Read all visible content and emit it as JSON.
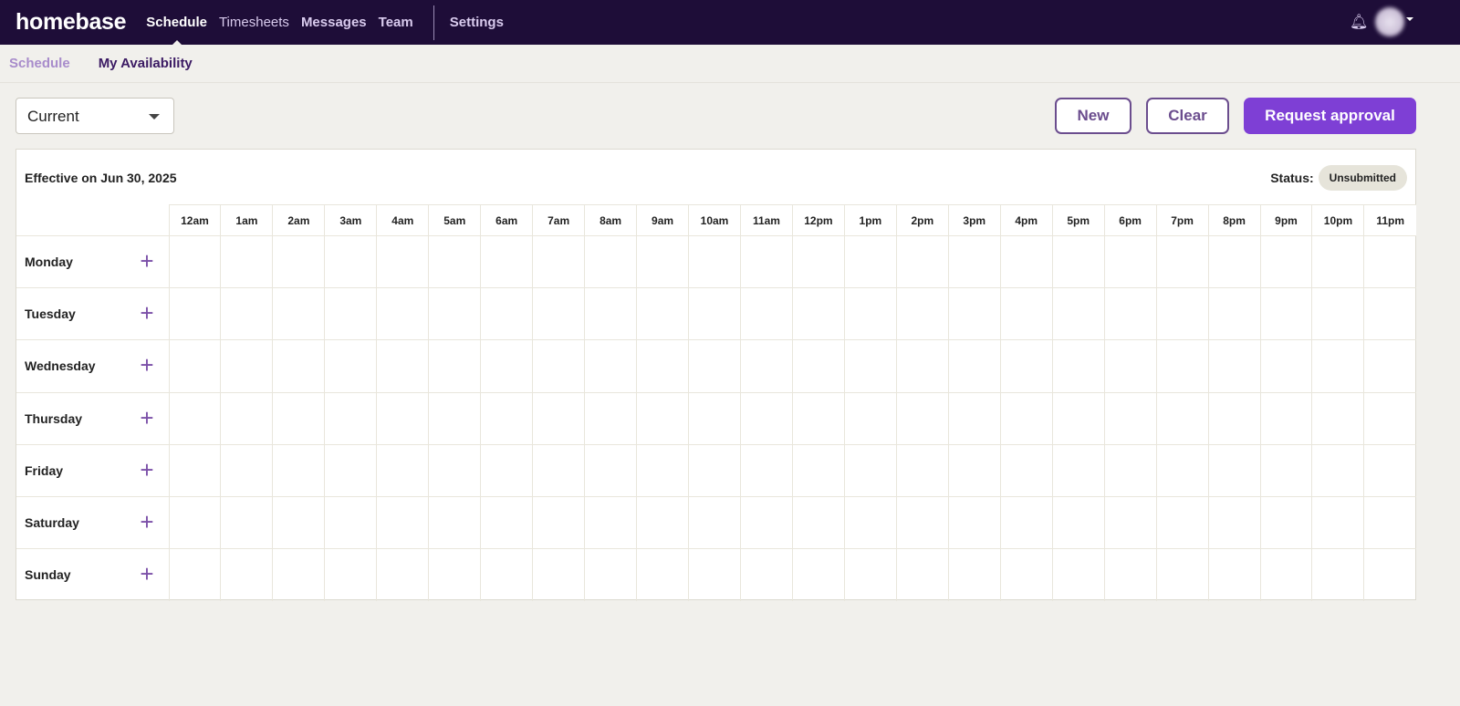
{
  "topbar": {
    "logo": "homebase",
    "nav": [
      "Schedule",
      "Timesheets",
      "Messages",
      "Team"
    ],
    "settings": "Settings"
  },
  "subnav": {
    "schedule": "Schedule",
    "availability": "My Availability"
  },
  "controls": {
    "select_value": "Current",
    "new": "New",
    "clear": "Clear",
    "request": "Request approval"
  },
  "card": {
    "effective": "Effective on Jun 30, 2025",
    "status_label": "Status:",
    "status_value": "Unsubmitted"
  },
  "hours": [
    "12am",
    "1am",
    "2am",
    "3am",
    "4am",
    "5am",
    "6am",
    "7am",
    "8am",
    "9am",
    "10am",
    "11am",
    "12pm",
    "1pm",
    "2pm",
    "3pm",
    "4pm",
    "5pm",
    "6pm",
    "7pm",
    "8pm",
    "9pm",
    "10pm",
    "11pm"
  ],
  "days": [
    "Monday",
    "Tuesday",
    "Wednesday",
    "Thursday",
    "Friday",
    "Saturday",
    "Sunday"
  ],
  "add_symbol": "+",
  "colors": {
    "topbar": "#1e0d38",
    "accent": "#7e3fd5"
  }
}
